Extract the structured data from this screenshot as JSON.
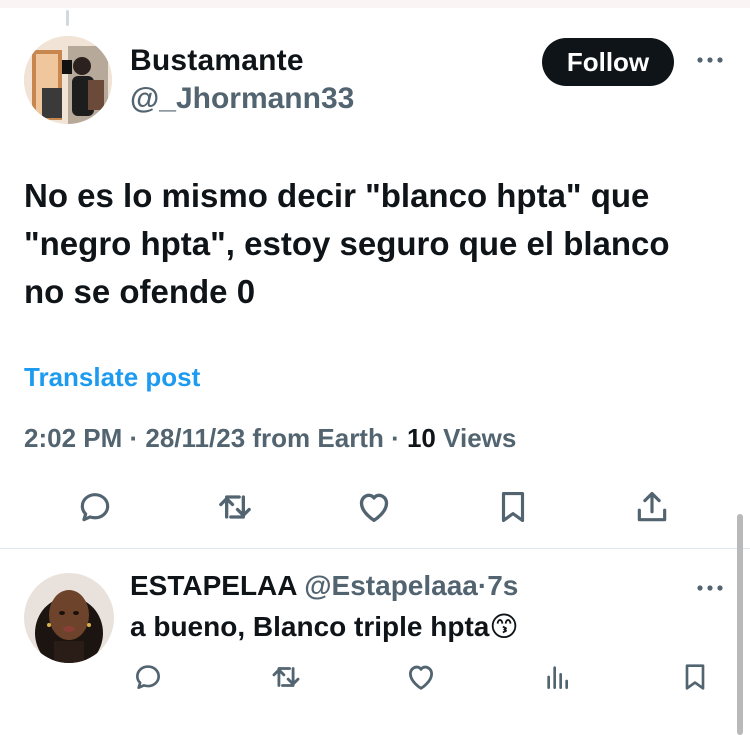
{
  "tweet": {
    "author_name": "Bustamante",
    "author_handle": "@_Jhormann33",
    "follow_label": "Follow",
    "text": "No es lo mismo decir \"blanco hpta\" que\n\"negro hpta\", estoy seguro que el blanco\nno se ofende 0",
    "translate_label": "Translate post",
    "time": "2:02 PM",
    "date": "28/11/23",
    "source": "from Earth",
    "views_count": "10",
    "views_label": "Views",
    "separator": " · "
  },
  "reply": {
    "author_name": "ESTAPELAA",
    "author_handle": "@Estapelaaa",
    "time_ago": "7s",
    "separator": "·",
    "text": "a bueno, Blanco triple hpta",
    "emoji": "😙"
  },
  "icons": {
    "more": "more-horizontal-icon",
    "reply": "reply-icon",
    "retweet": "retweet-icon",
    "like": "like-icon",
    "bookmark": "bookmark-icon",
    "share": "share-icon",
    "views": "views-icon"
  },
  "colors": {
    "text": "#0f1419",
    "secondary": "#536471",
    "accent": "#1d9bf0",
    "follow_bg": "#0f1419",
    "icon": "#536471"
  }
}
